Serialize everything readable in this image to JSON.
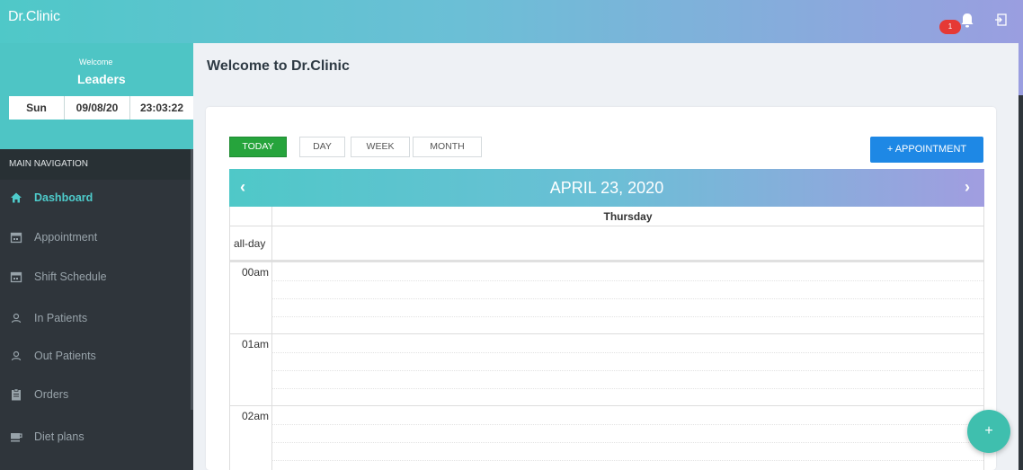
{
  "app": {
    "brand": "Dr.Clinic"
  },
  "topbar": {
    "notification_count": "1"
  },
  "welcome": {
    "greeting": "Welcome",
    "user": "Leaders"
  },
  "datetime": {
    "day": "Sun",
    "date": "09/08/20",
    "time": "23:03:22"
  },
  "navigation": {
    "header": "MAIN NAVIGATION",
    "items": [
      {
        "label": "Dashboard",
        "icon": "home-icon",
        "active": true
      },
      {
        "label": "Appointment",
        "icon": "calendar-icon"
      },
      {
        "label": "Shift Schedule",
        "icon": "calendar-icon"
      },
      {
        "label": "In Patients",
        "icon": "user-icon"
      },
      {
        "label": "Out Patients",
        "icon": "user-icon"
      },
      {
        "label": "Orders",
        "icon": "clipboard-icon"
      },
      {
        "label": "Diet plans",
        "icon": "cup-icon"
      }
    ]
  },
  "main": {
    "title": "Welcome to Dr.Clinic"
  },
  "calendar": {
    "views": [
      "TODAY",
      "DAY",
      "WEEK",
      "MONTH"
    ],
    "add_button": "+ APPOINTMENT",
    "title": "APRIL 23, 2020",
    "prev": "‹",
    "next": "›",
    "day_name": "Thursday",
    "allday_label": "all-day",
    "hours": [
      "00am",
      "01am",
      "02am"
    ]
  },
  "fab": {
    "label": "+"
  },
  "colors": {
    "accent": "#4ec5c5",
    "primary": "#1e88e5",
    "today": "#26a43c",
    "sidebar": "#2f353b"
  }
}
